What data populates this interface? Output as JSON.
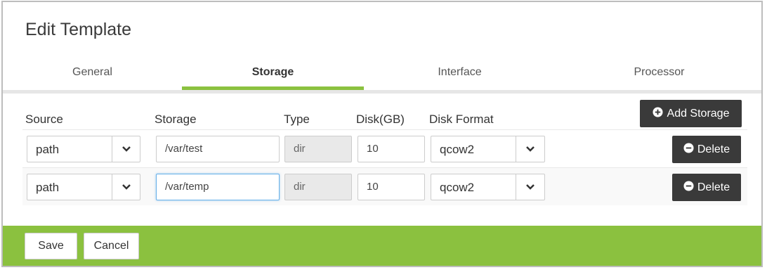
{
  "dialog": {
    "title": "Edit Template"
  },
  "tabs": [
    {
      "label": "General",
      "active": false
    },
    {
      "label": "Storage",
      "active": true
    },
    {
      "label": "Interface",
      "active": false
    },
    {
      "label": "Processor",
      "active": false
    }
  ],
  "columns": {
    "source": "Source",
    "storage": "Storage",
    "type": "Type",
    "disk": "Disk(GB)",
    "format": "Disk Format"
  },
  "add_storage_label": "Add Storage",
  "rows": [
    {
      "source": "path",
      "storage": "/var/test",
      "type": "dir",
      "disk": "10",
      "format": "qcow2",
      "delete_label": "Delete"
    },
    {
      "source": "path",
      "storage": "/var/temp",
      "type": "dir",
      "disk": "10",
      "format": "qcow2",
      "delete_label": "Delete"
    }
  ],
  "footer": {
    "save_label": "Save",
    "cancel_label": "Cancel"
  },
  "colors": {
    "accent": "#8bc13f",
    "dark_button": "#3a3a3a",
    "focus": "#66afe9"
  },
  "icons": {
    "add": "plus-circle-icon",
    "delete": "minus-circle-icon",
    "dropdown": "chevron-down-icon"
  }
}
